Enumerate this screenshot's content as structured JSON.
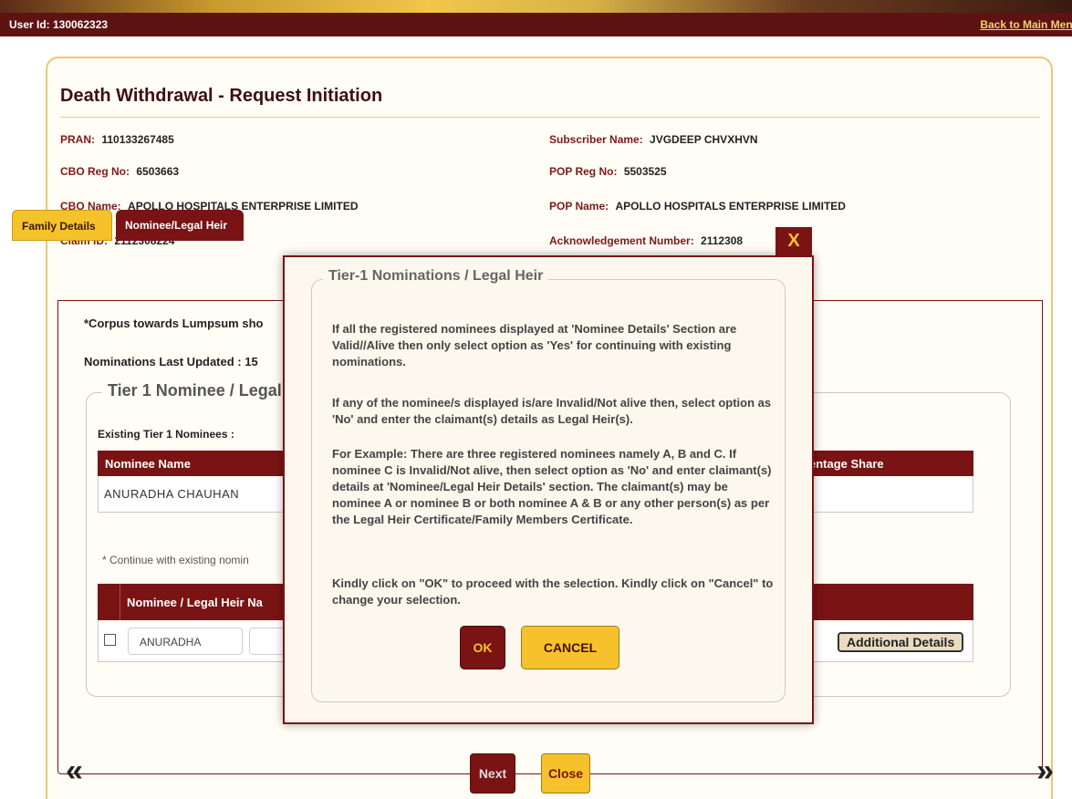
{
  "header": {
    "user_id": "User Id: 130062323",
    "back_link": "Back to Main Menu"
  },
  "page": {
    "title": "Death Withdrawal - Request Initiation",
    "pran_label": "PRAN:",
    "pran_value": "110133267485",
    "subscriber_label": "Subscriber Name:",
    "subscriber_value": "JVGDEEP CHVXHVN",
    "cbo_reg_label": "CBO Reg No:",
    "cbo_reg_value": "6503663",
    "pop_reg_label": "POP Reg No:",
    "pop_reg_value": "5503525",
    "cbo_name_label": "CBO Name:",
    "cbo_name_value": "APOLLO HOSPITALS ENTERPRISE LIMITED",
    "pop_name_label": "POP Name:",
    "pop_name_value": "APOLLO HOSPITALS ENTERPRISE LIMITED",
    "claim_label": "Claim ID:",
    "claim_value": "2112308224",
    "ack_label": "Acknowledgement Number:",
    "ack_value": "2112308"
  },
  "tabs": [
    {
      "label": "Family Details"
    },
    {
      "label": "Nominee/Legal Heir"
    }
  ],
  "content": {
    "corpus_note": "*Corpus towards Lumpsum sho",
    "nominations_updated": "Nominations Last Updated : 15",
    "fieldset_title": "Tier 1 Nominee / Legal",
    "existing_label": "Existing Tier 1 Nominees :",
    "nominee_col": "Nominee Name",
    "share_col": "entage Share",
    "nominee_value": "ANURADHA   CHAUHAN",
    "continue_label": "* Continue with existing nomin",
    "legal_header": "Nominee / Legal Heir Na",
    "legal_first_name": "ANURADHA",
    "additional_details": "Additional Details"
  },
  "nav": {
    "prev": "«",
    "next": "»",
    "next_label": "Next",
    "close_label": "Close"
  },
  "modal": {
    "close": "X",
    "title": "Tier-1 Nominations / Legal Heir",
    "para1": "If all the registered nominees displayed at 'Nominee Details' Section are Valid//Alive then only select option as 'Yes' for continuing with existing nominations.",
    "para2": "If any of the nominee/s displayed is/are Invalid/Not alive then, select option as 'No' and enter the claimant(s) details as Legal Heir(s).",
    "para3": "For Example: There are three registered nominees namely A, B and C. If nominee C is Invalid/Not alive, then select option as 'No' and enter claimant(s) details at 'Nominee/Legal Heir Details' section. The claimant(s) may be nominee A or nominee B or both nominee A & B or any other person(s) as per the Legal Heir Certificate/Family Members Certificate.",
    "para4": "Kindly click on \"OK\" to proceed with the selection. Kindly click on \"Cancel\" to change your selection.",
    "ok_label": "OK",
    "cancel_label": "CANCEL"
  }
}
